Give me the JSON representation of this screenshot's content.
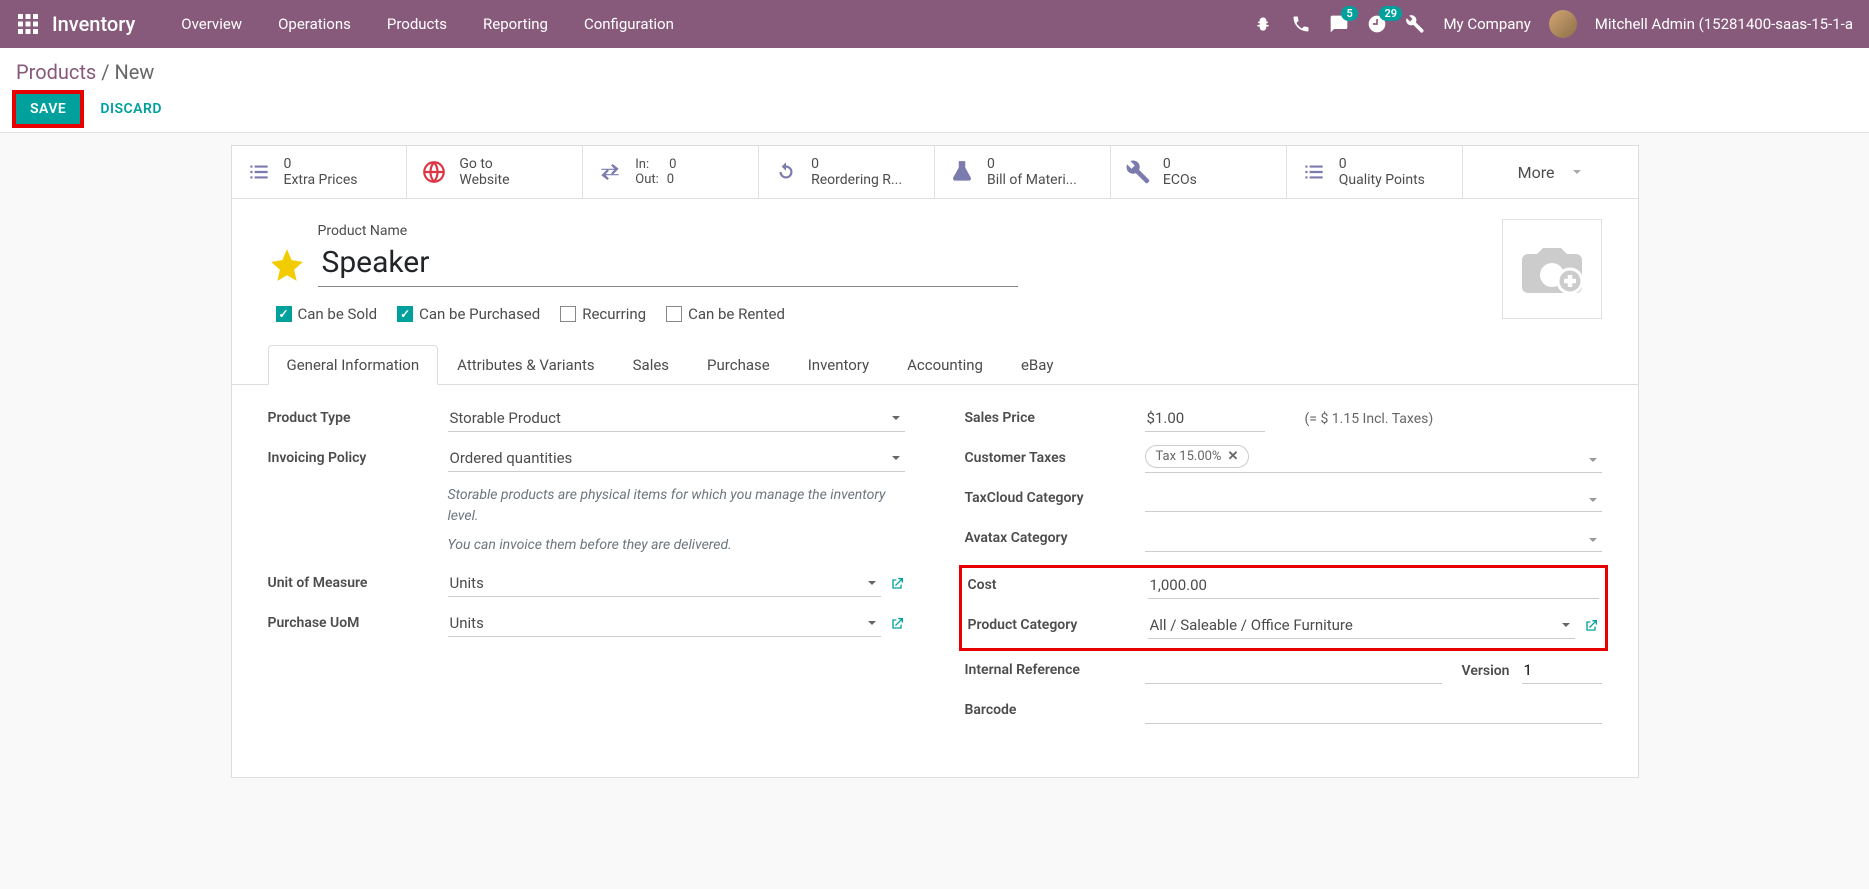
{
  "nav": {
    "brand": "Inventory",
    "items": [
      "Overview",
      "Operations",
      "Products",
      "Reporting",
      "Configuration"
    ],
    "msg_badge": "5",
    "activity_badge": "29",
    "company": "My Company",
    "user": "Mitchell Admin (15281400-saas-15-1-a"
  },
  "breadcrumb": {
    "root": "Products",
    "leaf": "New"
  },
  "buttons": {
    "save": "SAVE",
    "discard": "DISCARD"
  },
  "stats": {
    "extra_prices": {
      "val": "0",
      "lbl": "Extra Prices"
    },
    "website": {
      "l1": "Go to",
      "l2": "Website"
    },
    "inout": {
      "in_lbl": "In:",
      "in_val": "0",
      "out_lbl": "Out:",
      "out_val": "0"
    },
    "reorder": {
      "val": "0",
      "lbl": "Reordering R..."
    },
    "bom": {
      "val": "0",
      "lbl": "Bill of Materi..."
    },
    "eco": {
      "val": "0",
      "lbl": "ECOs"
    },
    "quality": {
      "val": "0",
      "lbl": "Quality Points"
    },
    "more": "More"
  },
  "product": {
    "name_label": "Product Name",
    "name": "Speaker",
    "checks": {
      "sold": "Can be Sold",
      "purchased": "Can be Purchased",
      "recurring": "Recurring",
      "rented": "Can be Rented"
    }
  },
  "tabs": [
    "General Information",
    "Attributes & Variants",
    "Sales",
    "Purchase",
    "Inventory",
    "Accounting",
    "eBay"
  ],
  "fields": {
    "product_type": {
      "label": "Product Type",
      "value": "Storable Product"
    },
    "invoicing": {
      "label": "Invoicing Policy",
      "value": "Ordered quantities"
    },
    "help1": "Storable products are physical items for which you manage the inventory level.",
    "help2": "You can invoice them before they are delivered.",
    "uom": {
      "label": "Unit of Measure",
      "value": "Units"
    },
    "purchase_uom": {
      "label": "Purchase UoM",
      "value": "Units"
    },
    "sales_price": {
      "label": "Sales Price",
      "value": "$1.00",
      "incl": "(= $ 1.15 Incl. Taxes)"
    },
    "customer_taxes": {
      "label": "Customer Taxes",
      "tag": "Tax 15.00%"
    },
    "taxcloud": {
      "label": "TaxCloud Category"
    },
    "avatax": {
      "label": "Avatax Category"
    },
    "cost": {
      "label": "Cost",
      "value": "1,000.00"
    },
    "category": {
      "label": "Product Category",
      "value": "All / Saleable / Office Furniture"
    },
    "internal_ref": {
      "label": "Internal Reference"
    },
    "version": {
      "label": "Version",
      "value": "1"
    },
    "barcode": {
      "label": "Barcode"
    }
  }
}
